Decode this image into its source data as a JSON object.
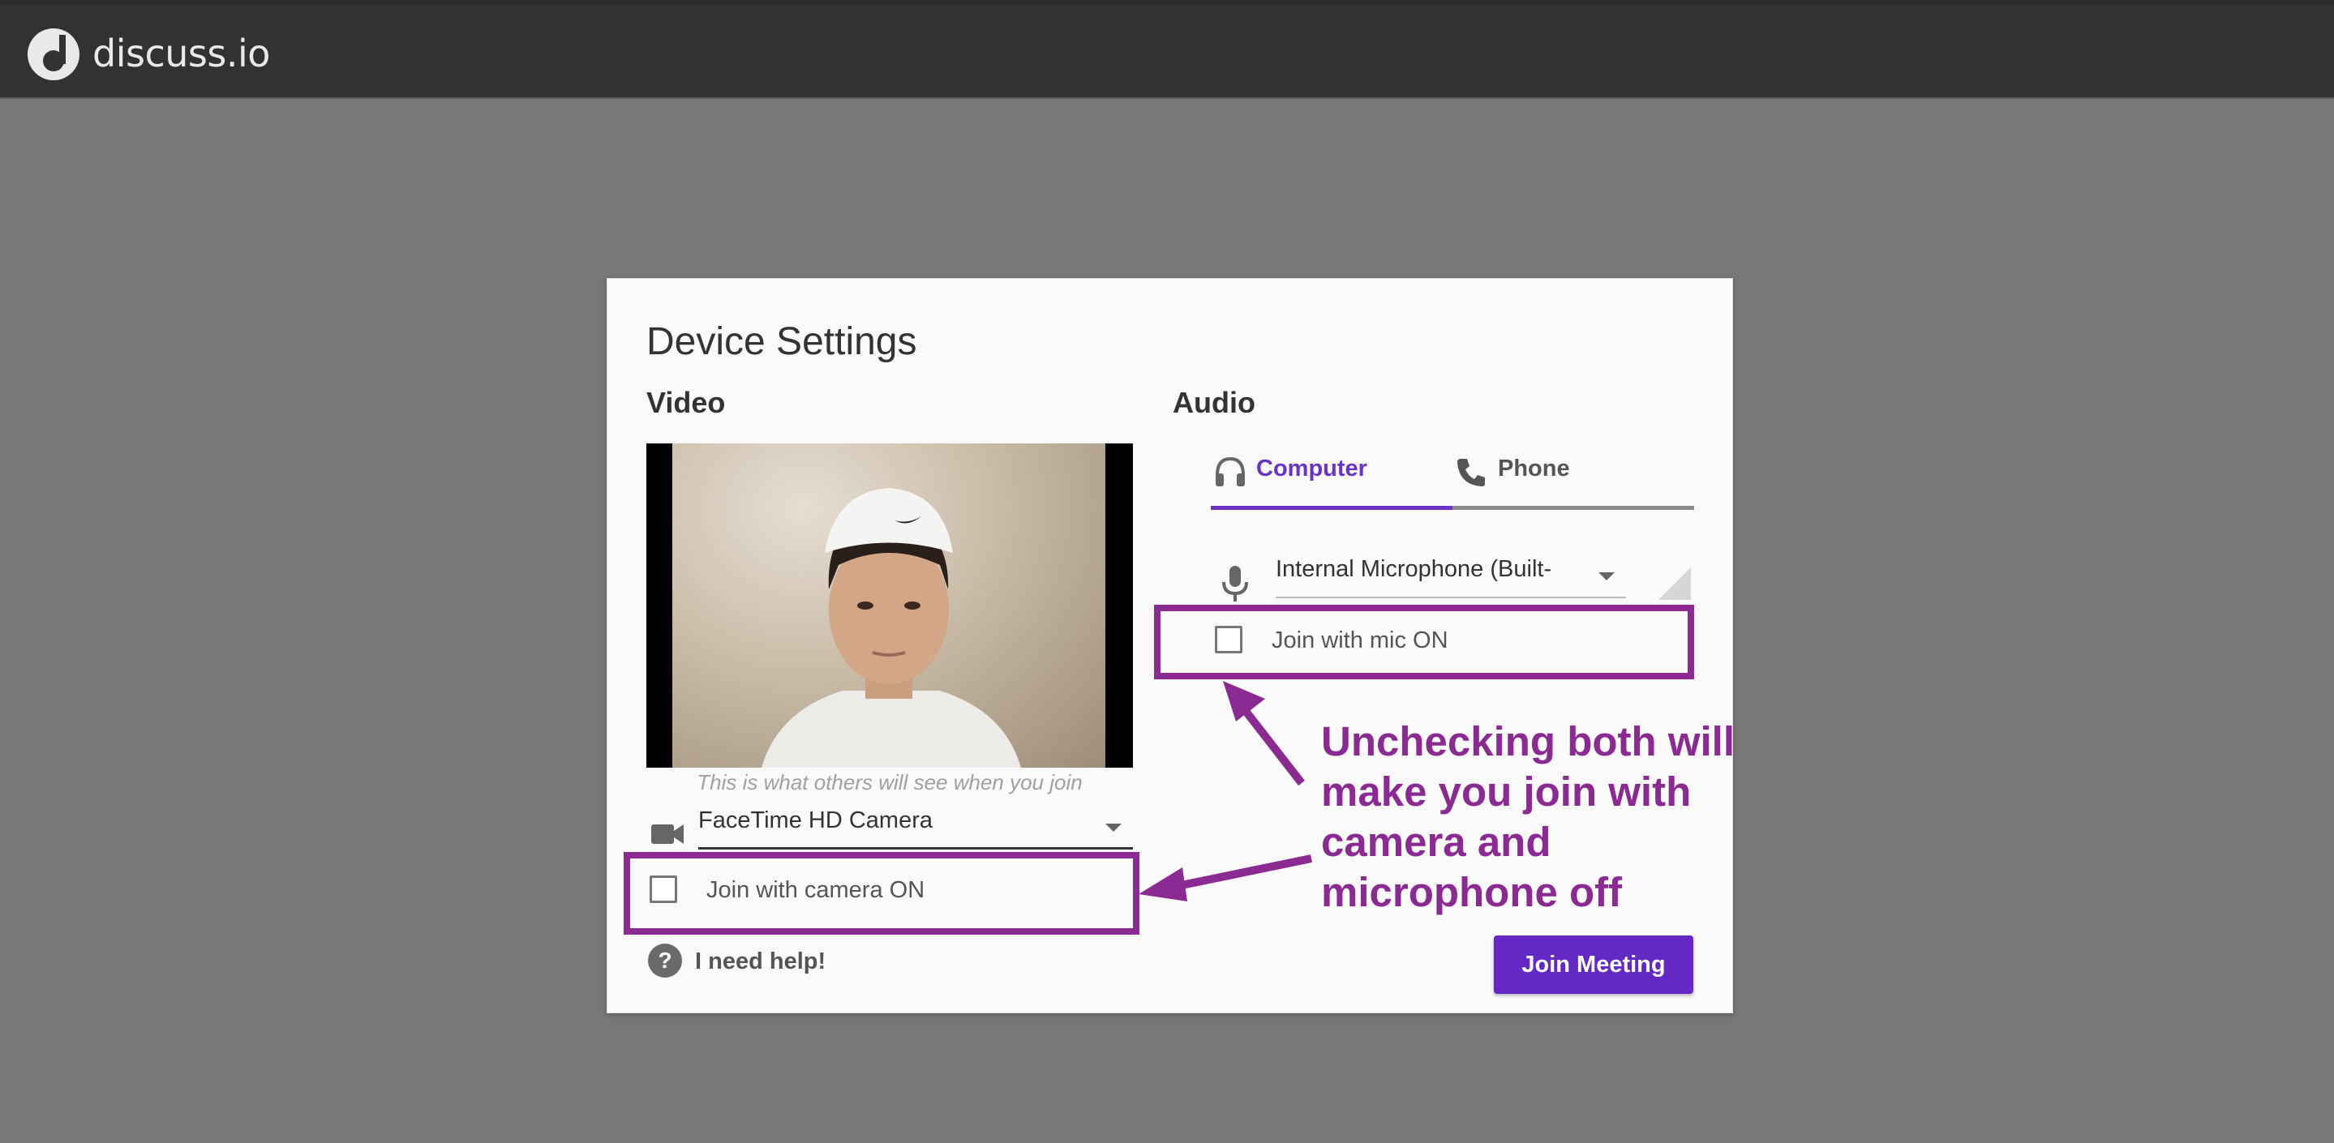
{
  "app": {
    "brand": "discuss.io"
  },
  "dialog": {
    "title": "Device Settings",
    "video": {
      "section_title": "Video",
      "preview_caption": "This is what others will see when you join",
      "camera_icon": "video-camera-icon",
      "camera_select_value": "FaceTime HD Camera",
      "join_with_camera_label": "Join with camera ON",
      "join_with_camera_checked": false
    },
    "audio": {
      "section_title": "Audio",
      "tabs": [
        {
          "label": "Computer",
          "icon": "headset-icon",
          "active": true
        },
        {
          "label": "Phone",
          "icon": "phone-icon",
          "active": false
        }
      ],
      "mic_icon": "microphone-icon",
      "mic_select_value": "Internal Microphone (Built-",
      "join_with_mic_label": "Join with mic ON",
      "join_with_mic_checked": false
    },
    "help_label": "I need help!",
    "help_icon": "question-circle-icon",
    "join_button_label": "Join Meeting"
  },
  "annotation": {
    "text": "Unchecking both will make you join with camera and microphone off",
    "color": "#8b2a92"
  },
  "colors": {
    "accent": "#6429c4",
    "topbar": "#323232",
    "backdrop": "#787878"
  }
}
